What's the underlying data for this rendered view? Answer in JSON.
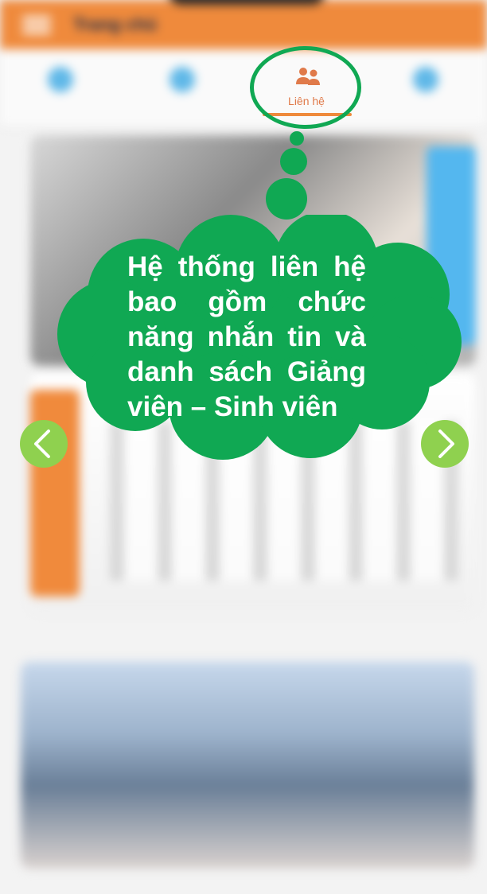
{
  "app": {
    "title": "Trang chủ"
  },
  "tabs": [
    {
      "icon": "tab-icon"
    },
    {
      "icon": "tab-icon"
    },
    {
      "label": "Liên hệ",
      "icon": "contacts-people-icon",
      "active": true
    },
    {
      "icon": "tab-icon"
    }
  ],
  "callout": {
    "text": "Hệ thống liên hệ bao gồm  chức năng nhắn tin và danh sách Giảng viên – Sinh viên"
  },
  "colors": {
    "header": "#ef8a3c",
    "accent_green": "#10a853",
    "arrow_green": "#8fd14f",
    "active_tab": "#e07a4a"
  },
  "navigation": {
    "prev_icon": "chevron-left-icon",
    "next_icon": "chevron-right-icon"
  }
}
